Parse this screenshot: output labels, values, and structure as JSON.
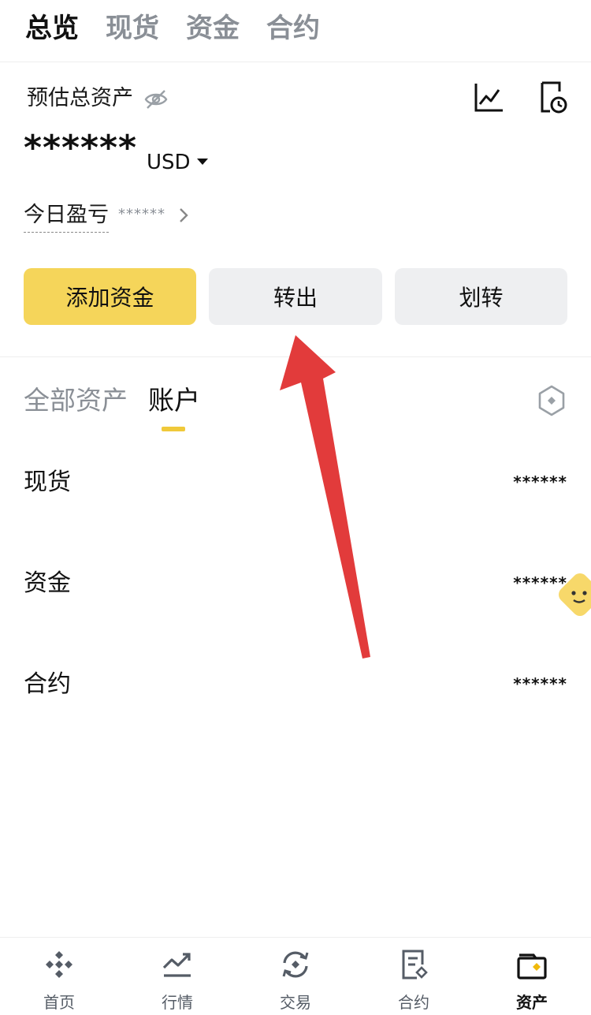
{
  "top_tabs": [
    {
      "label": "总览",
      "active": true
    },
    {
      "label": "现货",
      "active": false
    },
    {
      "label": "资金",
      "active": false
    },
    {
      "label": "合约",
      "active": false
    }
  ],
  "overview": {
    "estimated_label": "预估总资产",
    "balance_masked": "******",
    "currency": "USD",
    "today_pnl_label": "今日盈亏",
    "today_pnl_masked": "******"
  },
  "actions": {
    "add_funds": "添加资金",
    "withdraw": "转出",
    "transfer": "划转"
  },
  "sub_tabs": {
    "all_assets": "全部资产",
    "accounts": "账户"
  },
  "accounts": [
    {
      "name": "现货",
      "value": "******"
    },
    {
      "name": "资金",
      "value": "******"
    },
    {
      "name": "合约",
      "value": "******"
    }
  ],
  "bottom_nav": [
    {
      "label": "首页",
      "icon": "home-icon"
    },
    {
      "label": "行情",
      "icon": "markets-icon"
    },
    {
      "label": "交易",
      "icon": "trade-icon"
    },
    {
      "label": "合约",
      "icon": "futures-icon"
    },
    {
      "label": "资产",
      "icon": "wallet-icon",
      "active": true
    }
  ],
  "colors": {
    "accent": "#f5d55a",
    "tab_indicator": "#f0c93a",
    "annotation_arrow": "#e23b3b",
    "secondary_button": "#eeeff1"
  }
}
